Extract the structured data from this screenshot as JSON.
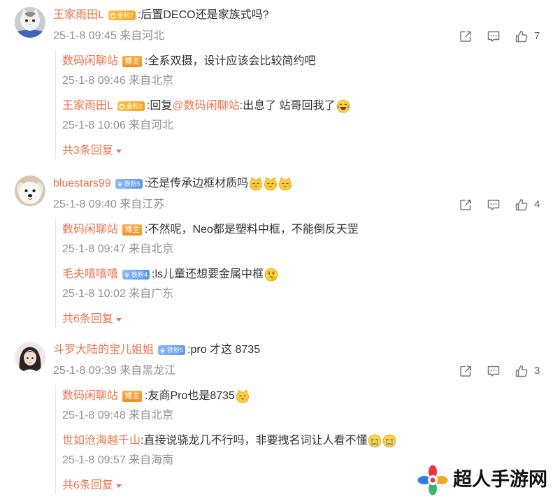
{
  "theme": {
    "username_color": "#eb7350",
    "text_color": "#333333",
    "meta_color": "#939393",
    "reply_border_color": "#e6e6e6",
    "gold_badge_color": "#f7a21b",
    "iron_badge_color": "#5b95ee",
    "author_badge_color": "#f49b35"
  },
  "comments": [
    {
      "username": "王家雨田L",
      "badge": {
        "label": "金粉2",
        "icon": "gold-fan-icon"
      },
      "text": ":后置DECO还是家族式吗?",
      "emojis": [],
      "meta": "25-1-8 09:45 来自河北",
      "actions": {
        "share": "share-icon",
        "comment": "comment-icon",
        "like": "like-icon",
        "like_count": "7"
      },
      "replies": [
        {
          "username": "数码闲聊站",
          "badge": {
            "label": "博主"
          },
          "text": ":全系双摄，设计应该会比较简约吧",
          "emojis": [],
          "meta": "25-1-8 09:46 来自北京"
        },
        {
          "username": "王家雨田L",
          "badge": {
            "label": "金粉2",
            "icon": "gold-fan-icon"
          },
          "text": ":回复",
          "mention": "@数码闲聊站",
          "text_after": ":出息了 站哥回我了",
          "emojis": [
            "laugh-cry-emoji-icon"
          ],
          "meta": "25-1-8 10:06 来自河北"
        }
      ],
      "more_replies": "共3条回复"
    },
    {
      "username": "bluestars99",
      "badge": {
        "label": "铁粉5",
        "icon": "iron-fan-icon"
      },
      "text": ":还是传承边框材质吗",
      "emojis": [
        "cat-emoji-icon",
        "cat-emoji-icon",
        "cat-emoji-icon"
      ],
      "meta": "25-1-8 09:40 来自江苏",
      "actions": {
        "share": "share-icon",
        "comment": "comment-icon",
        "like": "like-icon",
        "like_count": "4"
      },
      "replies": [
        {
          "username": "数码闲聊站",
          "badge": {
            "label": "博主"
          },
          "text": ":不然呢，Neo都是塑料中框，不能倒反天罡",
          "emojis": [],
          "meta": "25-1-8 09:47 来自北京"
        },
        {
          "username": "毛夫嘻嘻嘻",
          "badge": {
            "label": "铁粉4",
            "icon": "iron-fan-icon"
          },
          "text": ":ls儿童还想要金属中框",
          "emojis": [
            "thinking-emoji-icon"
          ],
          "meta": "25-1-8 10:02 来自广东"
        }
      ],
      "more_replies": "共6条回复"
    },
    {
      "username": "斗罗大陆的宝儿姐姐",
      "badge": {
        "label": "铁粉5",
        "icon": "iron-fan-icon"
      },
      "text": ":pro 才这 8735",
      "emojis": [],
      "meta": "25-1-8 09:39 来自黑龙江",
      "actions": {
        "share": "share-icon",
        "comment": "comment-icon",
        "like": "like-icon",
        "like_count": "3"
      },
      "replies": [
        {
          "username": "数码闲聊站",
          "badge": {
            "label": "博主"
          },
          "text": ":友商Pro也是8735",
          "emojis": [
            "cat-emoji-icon"
          ],
          "meta": "25-1-8 09:48 来自北京"
        },
        {
          "username": "世如沧海越千山",
          "text": ":直接说骁龙几不行吗，非要拽名词让人看不懂",
          "emojis": [
            "tear-emoji-icon",
            "tear-emoji-icon"
          ],
          "meta": "25-1-8 09:57 来自海南"
        }
      ],
      "more_replies": "共6条回复"
    }
  ],
  "watermark": {
    "logo": "site-logo-icon",
    "text": "超人手游网"
  }
}
